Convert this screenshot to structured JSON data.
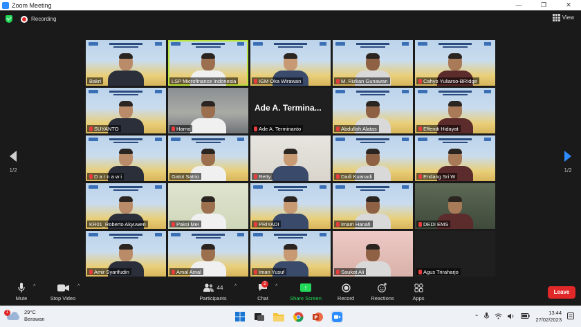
{
  "window": {
    "title": "Zoom Meeting",
    "controls": [
      "—",
      "❐",
      "✕"
    ]
  },
  "meeting": {
    "recording_label": "Recording",
    "view_label": "View"
  },
  "pager": {
    "left": "1/2",
    "right": "1/2"
  },
  "participants": [
    {
      "name": "Bakri",
      "muted": false,
      "bg": "blue"
    },
    {
      "name": "LSP Microfinance Indonesia",
      "muted": false,
      "bg": "blue",
      "active": true
    },
    {
      "name": "IGM Oka Wirawan",
      "muted": true,
      "bg": "blue"
    },
    {
      "name": "M. Rizkan Gunawan",
      "muted": true,
      "bg": "blue"
    },
    {
      "name": "Cahyo Yuliarso-BRIdge",
      "muted": true,
      "bg": "blue"
    },
    {
      "name": "SUYANTO",
      "muted": true,
      "bg": "blue"
    },
    {
      "name": "Harno",
      "muted": true,
      "bg": "room"
    },
    {
      "name": "Ade A. Terminanto",
      "muted": true,
      "bg": "dark",
      "display_name": "Ade A. Termina..."
    },
    {
      "name": "Abdullah Alatas",
      "muted": true,
      "bg": "blue"
    },
    {
      "name": "Effendi Hidayat",
      "muted": true,
      "bg": "blue"
    },
    {
      "name": "D a r n a w i",
      "muted": true,
      "bg": "blue"
    },
    {
      "name": "Gatot Satrio",
      "muted": false,
      "bg": "blue"
    },
    {
      "name": "Retty",
      "muted": true,
      "bg": "light"
    },
    {
      "name": "Dadi Kuanadi",
      "muted": true,
      "bg": "blue"
    },
    {
      "name": "Endang Sri W",
      "muted": true,
      "bg": "blue"
    },
    {
      "name": "KR01_Roberto Akyuwen",
      "muted": false,
      "bg": "blue"
    },
    {
      "name": "Paksi Mei",
      "muted": true,
      "bg": "green"
    },
    {
      "name": "PRIYADI",
      "muted": true,
      "bg": "blue"
    },
    {
      "name": "Imam Hanafi",
      "muted": true,
      "bg": "blue"
    },
    {
      "name": "DEDI EMS",
      "muted": true,
      "bg": "shop"
    },
    {
      "name": "Amir Syarifudin",
      "muted": true,
      "bg": "blue"
    },
    {
      "name": "Amal Amal",
      "muted": true,
      "bg": "blue"
    },
    {
      "name": "Iman Yusuf",
      "muted": true,
      "bg": "blue"
    },
    {
      "name": "Saukat Ali",
      "muted": true,
      "bg": "pink"
    },
    {
      "name": "Agus Triraharjo",
      "muted": true,
      "bg": "dark"
    }
  ],
  "toolbar": {
    "mute": "Mute",
    "stop_video": "Stop Video",
    "participants": "Participants",
    "participants_count": "44",
    "chat": "Chat",
    "chat_badge": "2",
    "share_screen": "Share Screen",
    "record": "Record",
    "reactions": "Reactions",
    "apps": "Apps",
    "leave": "Leave"
  },
  "taskbar": {
    "weather_temp": "29°C",
    "weather_desc": "Berawan",
    "weather_badge": "1",
    "time": "13:44",
    "date": "27/02/2023"
  },
  "colors": {
    "accent": "#2d8cff",
    "share": "#23d959",
    "leave": "#e02828",
    "active_speaker": "#b9e23b"
  }
}
